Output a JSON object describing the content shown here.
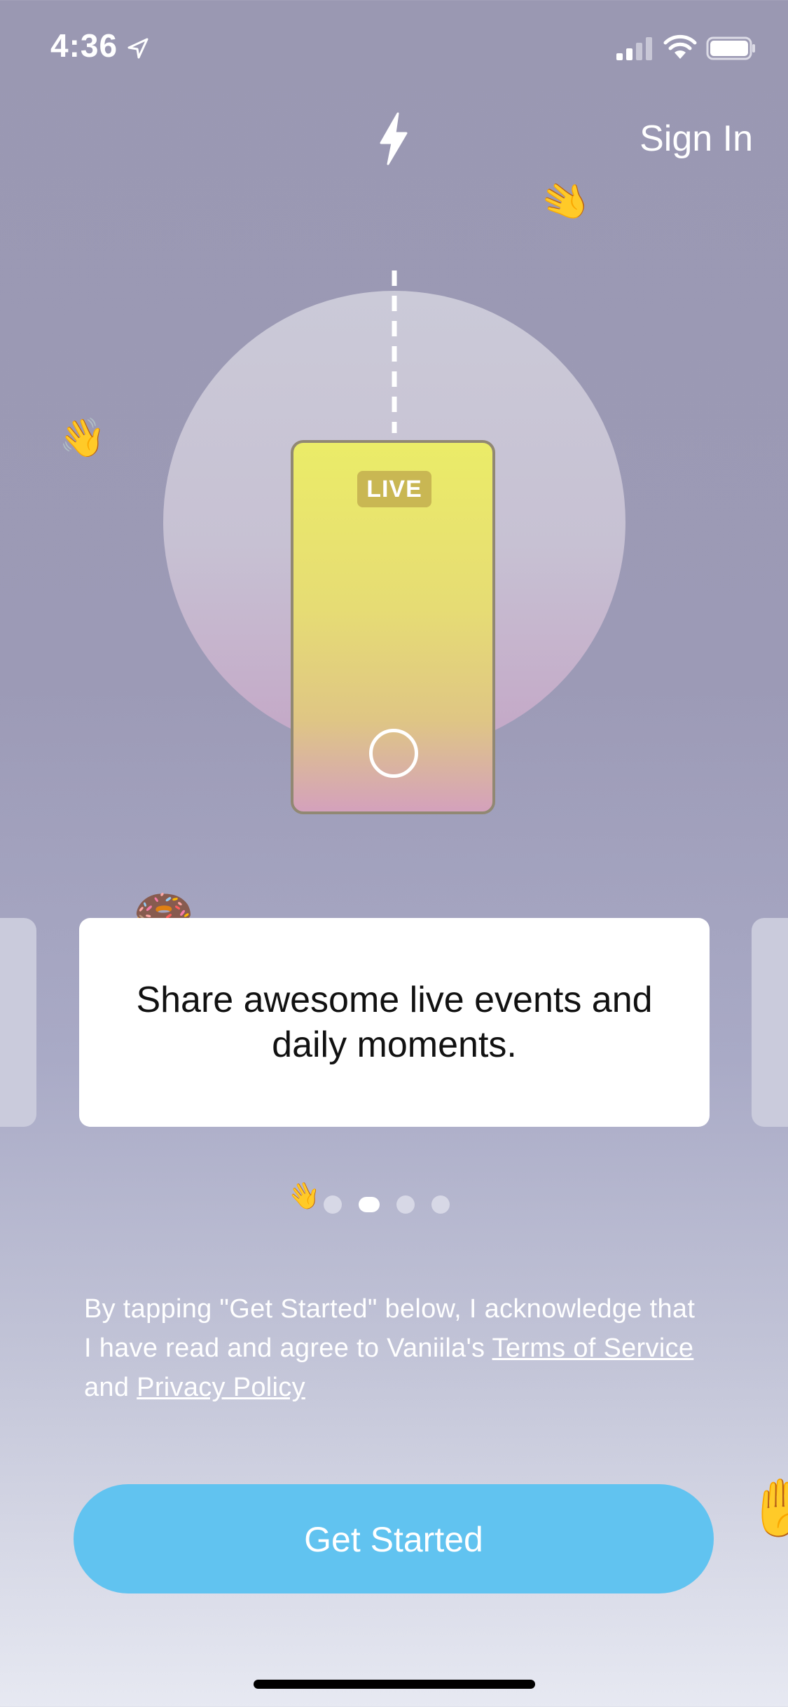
{
  "status_bar": {
    "time": "4:36"
  },
  "header": {
    "sign_in_label": "Sign In"
  },
  "hero": {
    "live_badge": "LIVE"
  },
  "carousel": {
    "card_text": "Share awesome live events and daily moments.",
    "page_count": 4,
    "active_index": 1
  },
  "legal": {
    "prefix": "By tapping \"Get Started\" below, I acknowledge that I have read and agree to Vaniila's ",
    "terms_link": "Terms of Service",
    "conjunction": " and ",
    "privacy_link": "Privacy Policy"
  },
  "cta": {
    "label": "Get Started"
  },
  "colors": {
    "accent": "#61c3f0",
    "phone_top": "#ebec68",
    "phone_bottom": "#d4a1bc",
    "background_top": "#9a98b2",
    "background_bottom": "#e7e9f2"
  },
  "icons": [
    "location-arrow-icon",
    "cellular-signal-icon",
    "wifi-icon",
    "battery-icon",
    "lightning-bolt-icon",
    "record-button-icon",
    "waving-hand-icon"
  ]
}
